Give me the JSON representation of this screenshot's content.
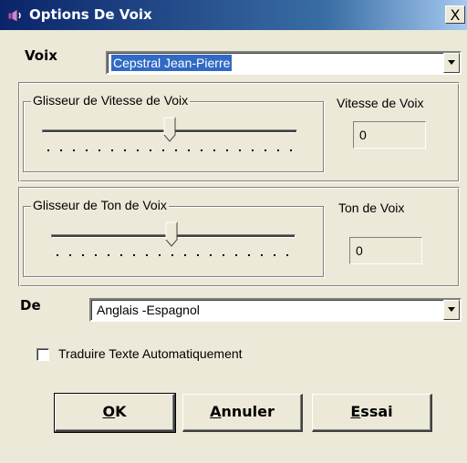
{
  "window": {
    "title": "Options De Voix",
    "close_label": "X"
  },
  "voice": {
    "label": "Voix",
    "selected": "Cepstral Jean-Pierre"
  },
  "speed": {
    "group_label": "Glisseur de Vitesse de Voix",
    "readout_label": "Vitesse de Voix",
    "value": "0",
    "slider_position": 0.5
  },
  "pitch": {
    "group_label": "Glisseur de Ton de Voix",
    "readout_label": "Ton de Voix",
    "value": "0",
    "slider_position": 0.5
  },
  "language": {
    "label": "De",
    "selected": "Anglais -Espagnol"
  },
  "auto_translate": {
    "label": "Traduire Texte Automatiquement",
    "checked": false
  },
  "buttons": {
    "ok_first": "O",
    "ok_rest": "K",
    "cancel_first": "A",
    "cancel_rest": "nnuler",
    "test_first": "E",
    "test_rest": "ssai"
  }
}
